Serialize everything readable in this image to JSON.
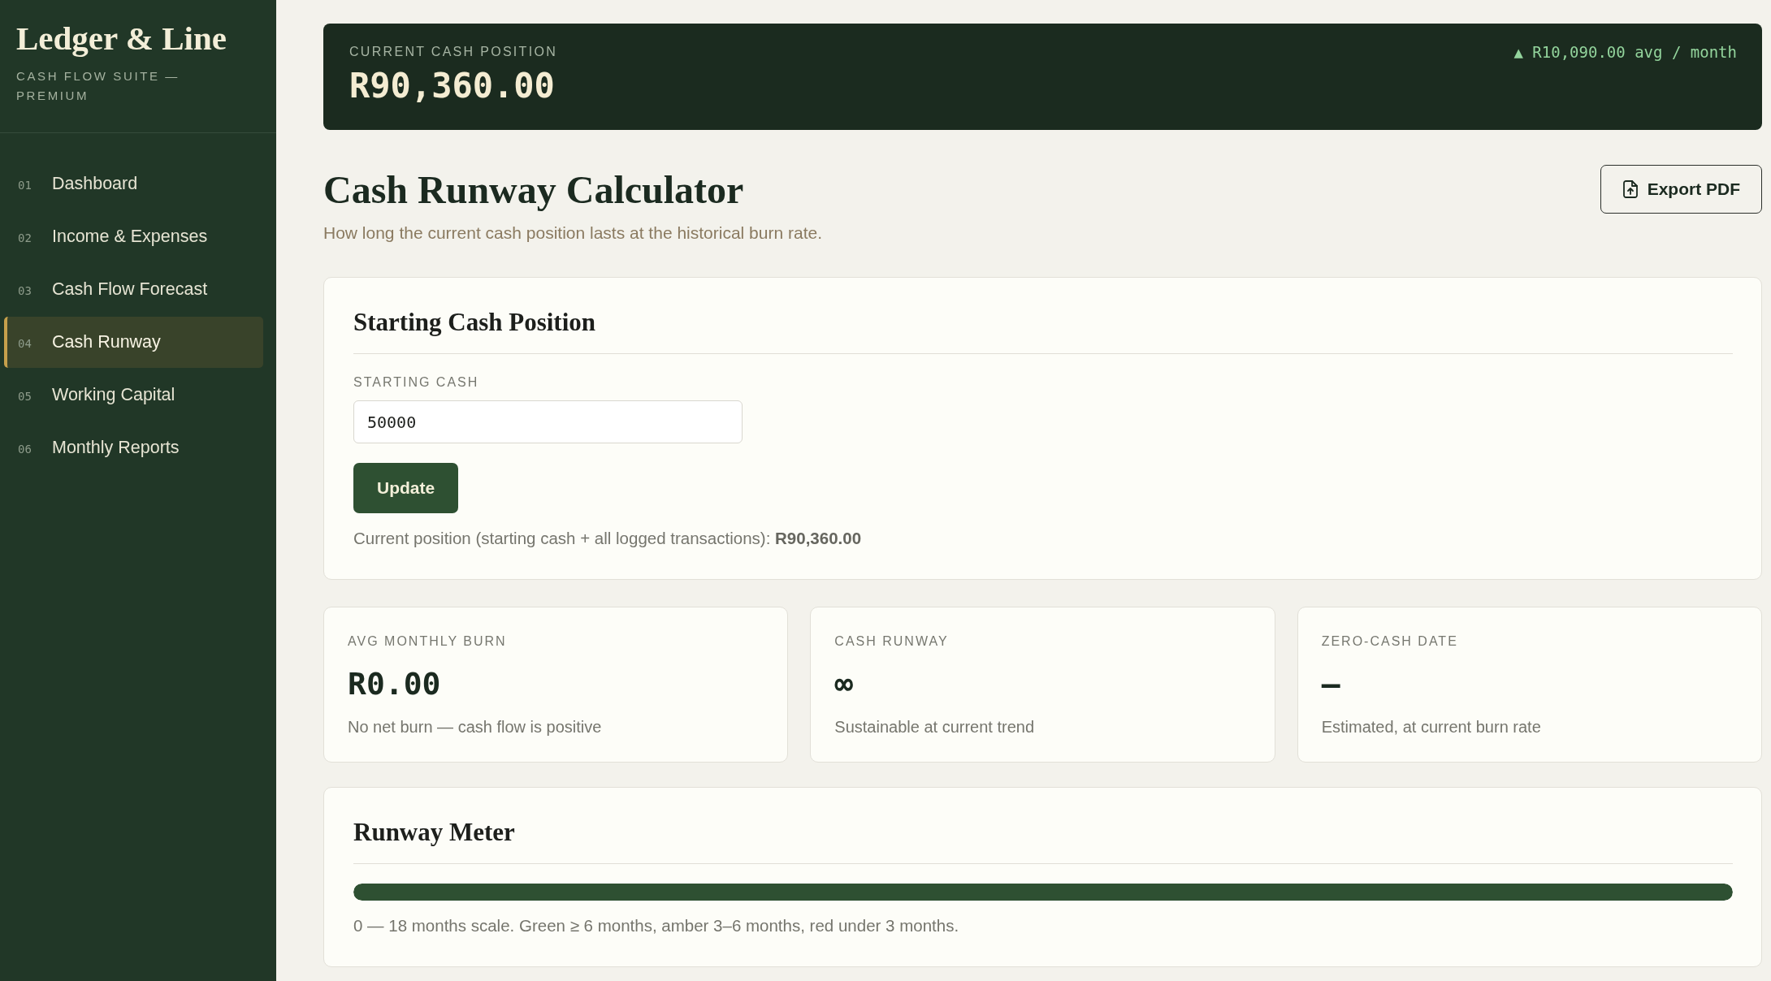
{
  "sidebar": {
    "brand": "Ledger & Line",
    "tagline": "CASH FLOW SUITE — PREMIUM",
    "items": [
      {
        "number": "01",
        "label": "Dashboard",
        "selected": false
      },
      {
        "number": "02",
        "label": "Income & Expenses",
        "selected": false
      },
      {
        "number": "03",
        "label": "Cash Flow Forecast",
        "selected": false
      },
      {
        "number": "04",
        "label": "Cash Runway",
        "selected": true
      },
      {
        "number": "05",
        "label": "Working Capital",
        "selected": false
      },
      {
        "number": "06",
        "label": "Monthly Reports",
        "selected": false
      }
    ]
  },
  "cash_banner": {
    "label": "CURRENT CASH POSITION",
    "value": "R90,360.00",
    "trend": "▲ R10,090.00 avg / month"
  },
  "header": {
    "title": "Cash Runway Calculator",
    "subtitle": "How long the current cash position lasts at the historical burn rate.",
    "export_button": "Export PDF"
  },
  "starting_cash": {
    "title": "Starting Cash Position",
    "field": {
      "label": "STARTING CASH",
      "value": "50000"
    },
    "button": "Update",
    "note": "Current position (starting cash + all logged transactions): **R90,360.00**"
  },
  "stats": [
    {
      "label": "AVG MONTHLY BURN",
      "value": "R0.00",
      "note": "No net burn — cash flow is positive"
    },
    {
      "label": "CASH RUNWAY",
      "value": "∞",
      "note": "Sustainable at current trend"
    },
    {
      "label": "ZERO-CASH DATE",
      "value": "—",
      "note": "Estimated, at current burn rate"
    }
  ],
  "runway_meter": {
    "title": "Runway Meter",
    "level": 1,
    "note": "0 — 18 months scale. Green ≥ 6 months, amber 3–6 months, red under 3 months."
  }
}
